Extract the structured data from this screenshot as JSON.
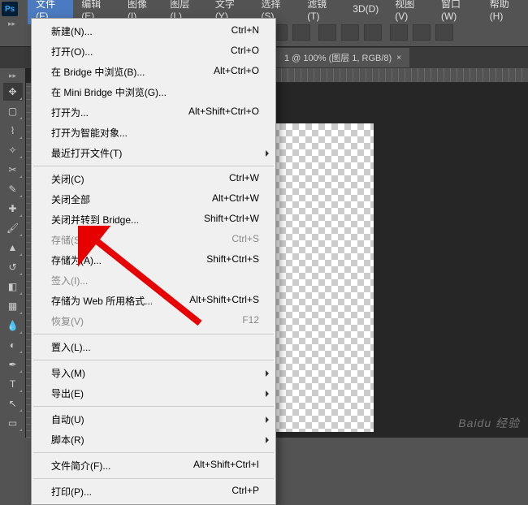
{
  "logo": "Ps",
  "menubar": {
    "file": "文件(F)",
    "edit": "编辑(E)",
    "image": "图像(I)",
    "layer": "图层(L)",
    "type": "文字(Y)",
    "select": "选择(S)",
    "filter": "滤镜(T)",
    "threed": "3D(D)",
    "view": "视图(V)",
    "window": "窗口(W)",
    "help": "帮助(H)"
  },
  "tab": {
    "title": "1 @ 100% (图层 1, RGB/8)",
    "close": "×"
  },
  "file_menu": {
    "new": "新建(N)...",
    "new_sc": "Ctrl+N",
    "open": "打开(O)...",
    "open_sc": "Ctrl+O",
    "browse_bridge": "在 Bridge 中浏览(B)...",
    "browse_bridge_sc": "Alt+Ctrl+O",
    "browse_minibridge": "在 Mini Bridge 中浏览(G)...",
    "open_as": "打开为...",
    "open_as_sc": "Alt+Shift+Ctrl+O",
    "open_smart": "打开为智能对象...",
    "recent": "最近打开文件(T)",
    "close": "关闭(C)",
    "close_sc": "Ctrl+W",
    "close_all": "关闭全部",
    "close_all_sc": "Alt+Ctrl+W",
    "close_bridge": "关闭并转到 Bridge...",
    "close_bridge_sc": "Shift+Ctrl+W",
    "save": "存储(S)",
    "save_sc": "Ctrl+S",
    "save_as": "存储为(A)...",
    "save_as_sc": "Shift+Ctrl+S",
    "checkin": "签入(I)...",
    "save_web": "存储为 Web 所用格式...",
    "save_web_sc": "Alt+Shift+Ctrl+S",
    "revert": "恢复(V)",
    "revert_sc": "F12",
    "place": "置入(L)...",
    "import": "导入(M)",
    "export": "导出(E)",
    "automate": "自动(U)",
    "scripts": "脚本(R)",
    "file_info": "文件简介(F)...",
    "file_info_sc": "Alt+Shift+Ctrl+I",
    "print": "打印(P)...",
    "print_sc": "Ctrl+P"
  },
  "watermark": "Baidu 经验"
}
